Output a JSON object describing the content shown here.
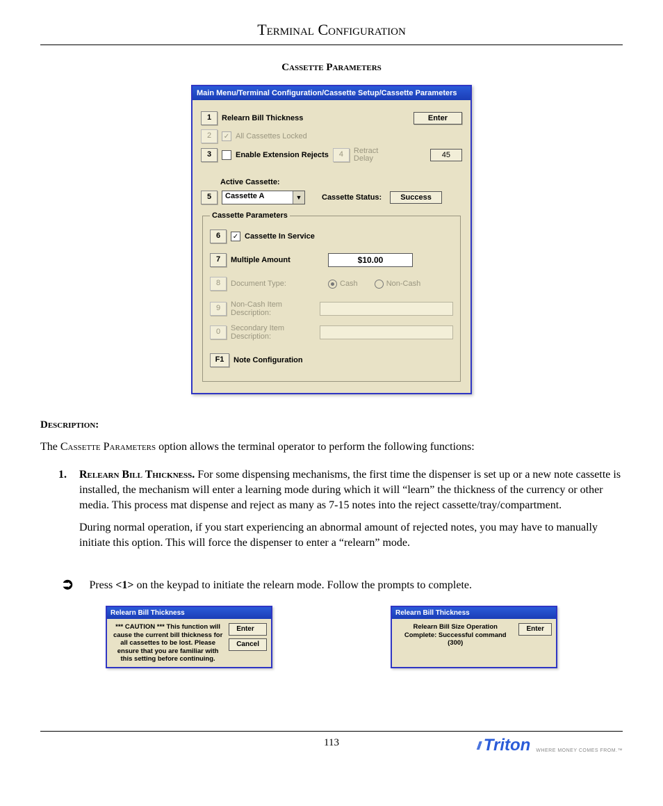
{
  "header_title": "Terminal Configuration",
  "section_title": "Cassette Parameters",
  "main_dialog": {
    "title": "Main Menu/Terminal Configuration/Cassette Setup/Cassette Parameters",
    "enter_label": "Enter",
    "row1": {
      "key": "1",
      "label": "Relearn Bill Thickness"
    },
    "row2": {
      "key": "2",
      "label": "All Cassettes Locked",
      "checked": true
    },
    "row3": {
      "key": "3",
      "label": "Enable Extension Rejects"
    },
    "row4": {
      "key": "4",
      "label": "Retract Delay",
      "value": "45"
    },
    "active_label": "Active Cassette:",
    "row5": {
      "key": "5",
      "value": "Cassette A"
    },
    "status_label": "Cassette Status:",
    "status_value": "Success",
    "params_legend": "Cassette Parameters",
    "row6": {
      "key": "6",
      "label": "Cassette In Service",
      "checked": true
    },
    "row7": {
      "key": "7",
      "label": "Multiple Amount",
      "value": "$10.00"
    },
    "row8": {
      "key": "8",
      "label": "Document Type:",
      "opt1": "Cash",
      "opt2": "Non-Cash"
    },
    "row9": {
      "key": "9",
      "label": "Non-Cash Item Description:"
    },
    "row0": {
      "key": "0",
      "label": "Secondary Item Description:"
    },
    "rowF1": {
      "key": "F1",
      "label": "Note Configuration"
    }
  },
  "desc_head": "Description:",
  "desc_intro_pre": "The ",
  "desc_intro_sc": "Cassette Parameters",
  "desc_intro_post": " option allows the terminal operator to perform the following functions:",
  "item1": {
    "num": "1.",
    "lead": "Relearn Bill Thickness.",
    "p1": "  For some dispensing mechanisms, the first time the dispenser is set up or a new note cassette is installed, the mechanism will enter a learning mode during which it will “learn” the thickness of the currency or other media. This process mat dispense and reject as many as 7-15 notes into the reject cassette/tray/compartment.",
    "p2": "During normal operation, if you start experiencing an abnormal amount of rejected notes, you may have to manually initiate this option. This will force the dispenser to enter a “relearn” mode."
  },
  "arrow_text_pre": "Press ",
  "arrow_text_key": "<1>",
  "arrow_text_post": " on the keypad to initiate the relearn mode. Follow the prompts to complete.",
  "mini": {
    "left": {
      "title": "Relearn Bill Thickness",
      "text": "*** CAUTION ***\nThis function will cause the current bill thickness for all cassettes to be lost. Please ensure that you are familiar with this setting before continuing.",
      "btn_enter": "Enter",
      "btn_cancel": "Cancel"
    },
    "right": {
      "title": "Relearn Bill Thickness",
      "text": "Relearn Bill Size Operation Complete: Successful command (300)",
      "btn_enter": "Enter"
    }
  },
  "page_number": "113",
  "brand_name": "Triton",
  "brand_tag": "WHERE MONEY COMES FROM.™"
}
